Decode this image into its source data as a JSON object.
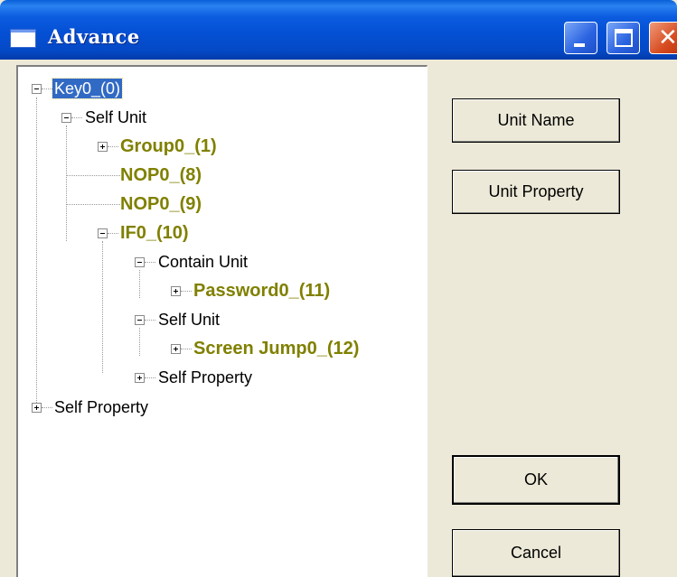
{
  "window": {
    "title": "Advance"
  },
  "tree": {
    "root": "Key0_(0)",
    "self_unit_1": "Self Unit",
    "group": "Group0_(1)",
    "nop_8": "NOP0_(8)",
    "nop_9": "NOP0_(9)",
    "if": "IF0_(10)",
    "contain_unit": "Contain Unit",
    "password": "Password0_(11)",
    "self_unit_2": "Self Unit",
    "screen_jump": "Screen Jump0_(12)",
    "self_property_inner": "Self Property",
    "self_property_root": "Self Property"
  },
  "buttons": {
    "unit_name": "Unit Name",
    "unit_property": "Unit Property",
    "ok": "OK",
    "cancel": "Cancel"
  },
  "colors": {
    "unit_text": "#808000",
    "selection": "#316ac5",
    "titlebar": "#0450d5"
  }
}
